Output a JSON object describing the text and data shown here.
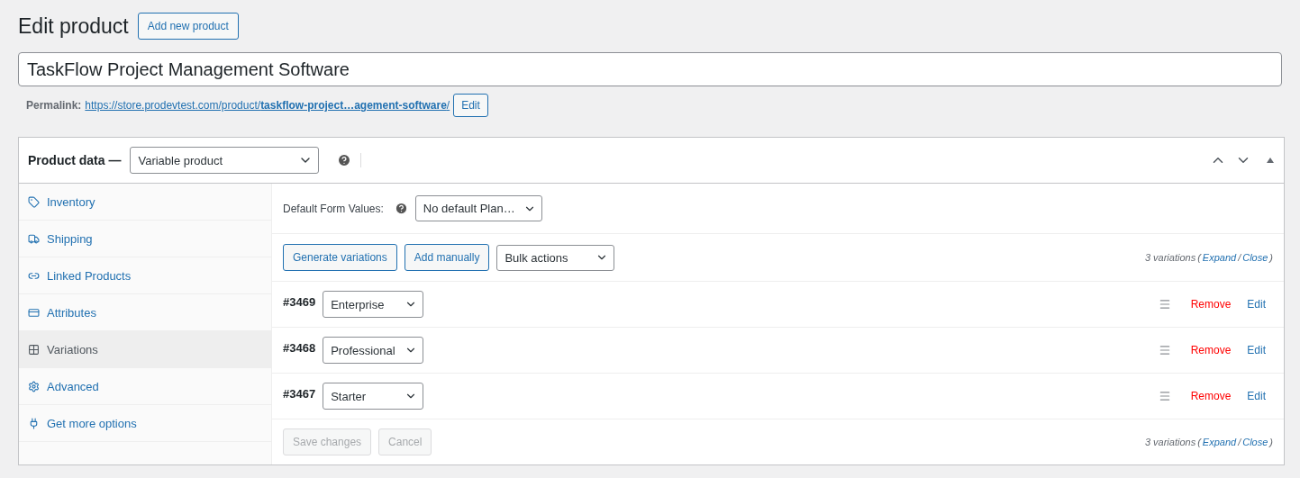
{
  "page": {
    "title": "Edit product",
    "add_button": "Add new product"
  },
  "product_title": {
    "value": "TaskFlow Project Management Software"
  },
  "permalink": {
    "label": "Permalink:",
    "url": "https://store.prodevtest.com/product/**taskflow-project…agement-software**/",
    "edit": "Edit"
  },
  "product_data": {
    "label": "Product data —",
    "type": "Variable product"
  },
  "tabs": [
    {
      "label": "Inventory",
      "selected": false
    },
    {
      "label": "Shipping",
      "selected": false
    },
    {
      "label": "Linked Products",
      "selected": false
    },
    {
      "label": "Attributes",
      "selected": false
    },
    {
      "label": "Variations",
      "selected": true
    },
    {
      "label": "Advanced",
      "selected": false
    },
    {
      "label": "Get more options",
      "selected": false
    }
  ],
  "defaults": {
    "label": "Default Form Values:",
    "value": "No default Plan…"
  },
  "toolbar": {
    "buttons": [
      "Generate variations",
      "Add manually"
    ],
    "bulk": "Bulk actions"
  },
  "summary_top": {
    "count": "3 variations",
    "open": "(",
    "expand": "Expand",
    "sep": "/",
    "close": "Close",
    "end": ")"
  },
  "variations": [
    {
      "id": "#3469",
      "plan": "Enterprise",
      "remove": "Remove",
      "edit": "Edit"
    },
    {
      "id": "#3468",
      "plan": "Professional",
      "remove": "Remove",
      "edit": "Edit"
    },
    {
      "id": "#3467",
      "plan": "Starter",
      "remove": "Remove",
      "edit": "Edit"
    }
  ],
  "footer": {
    "save": {
      "label": "Save changes",
      "disabled": true
    },
    "cancel": {
      "label": "Cancel",
      "disabled": true
    }
  },
  "summary_bottom": {
    "count": "3 variations",
    "open": "(",
    "expand": "Expand",
    "sep": "/",
    "close": "Close",
    "end": ")"
  }
}
